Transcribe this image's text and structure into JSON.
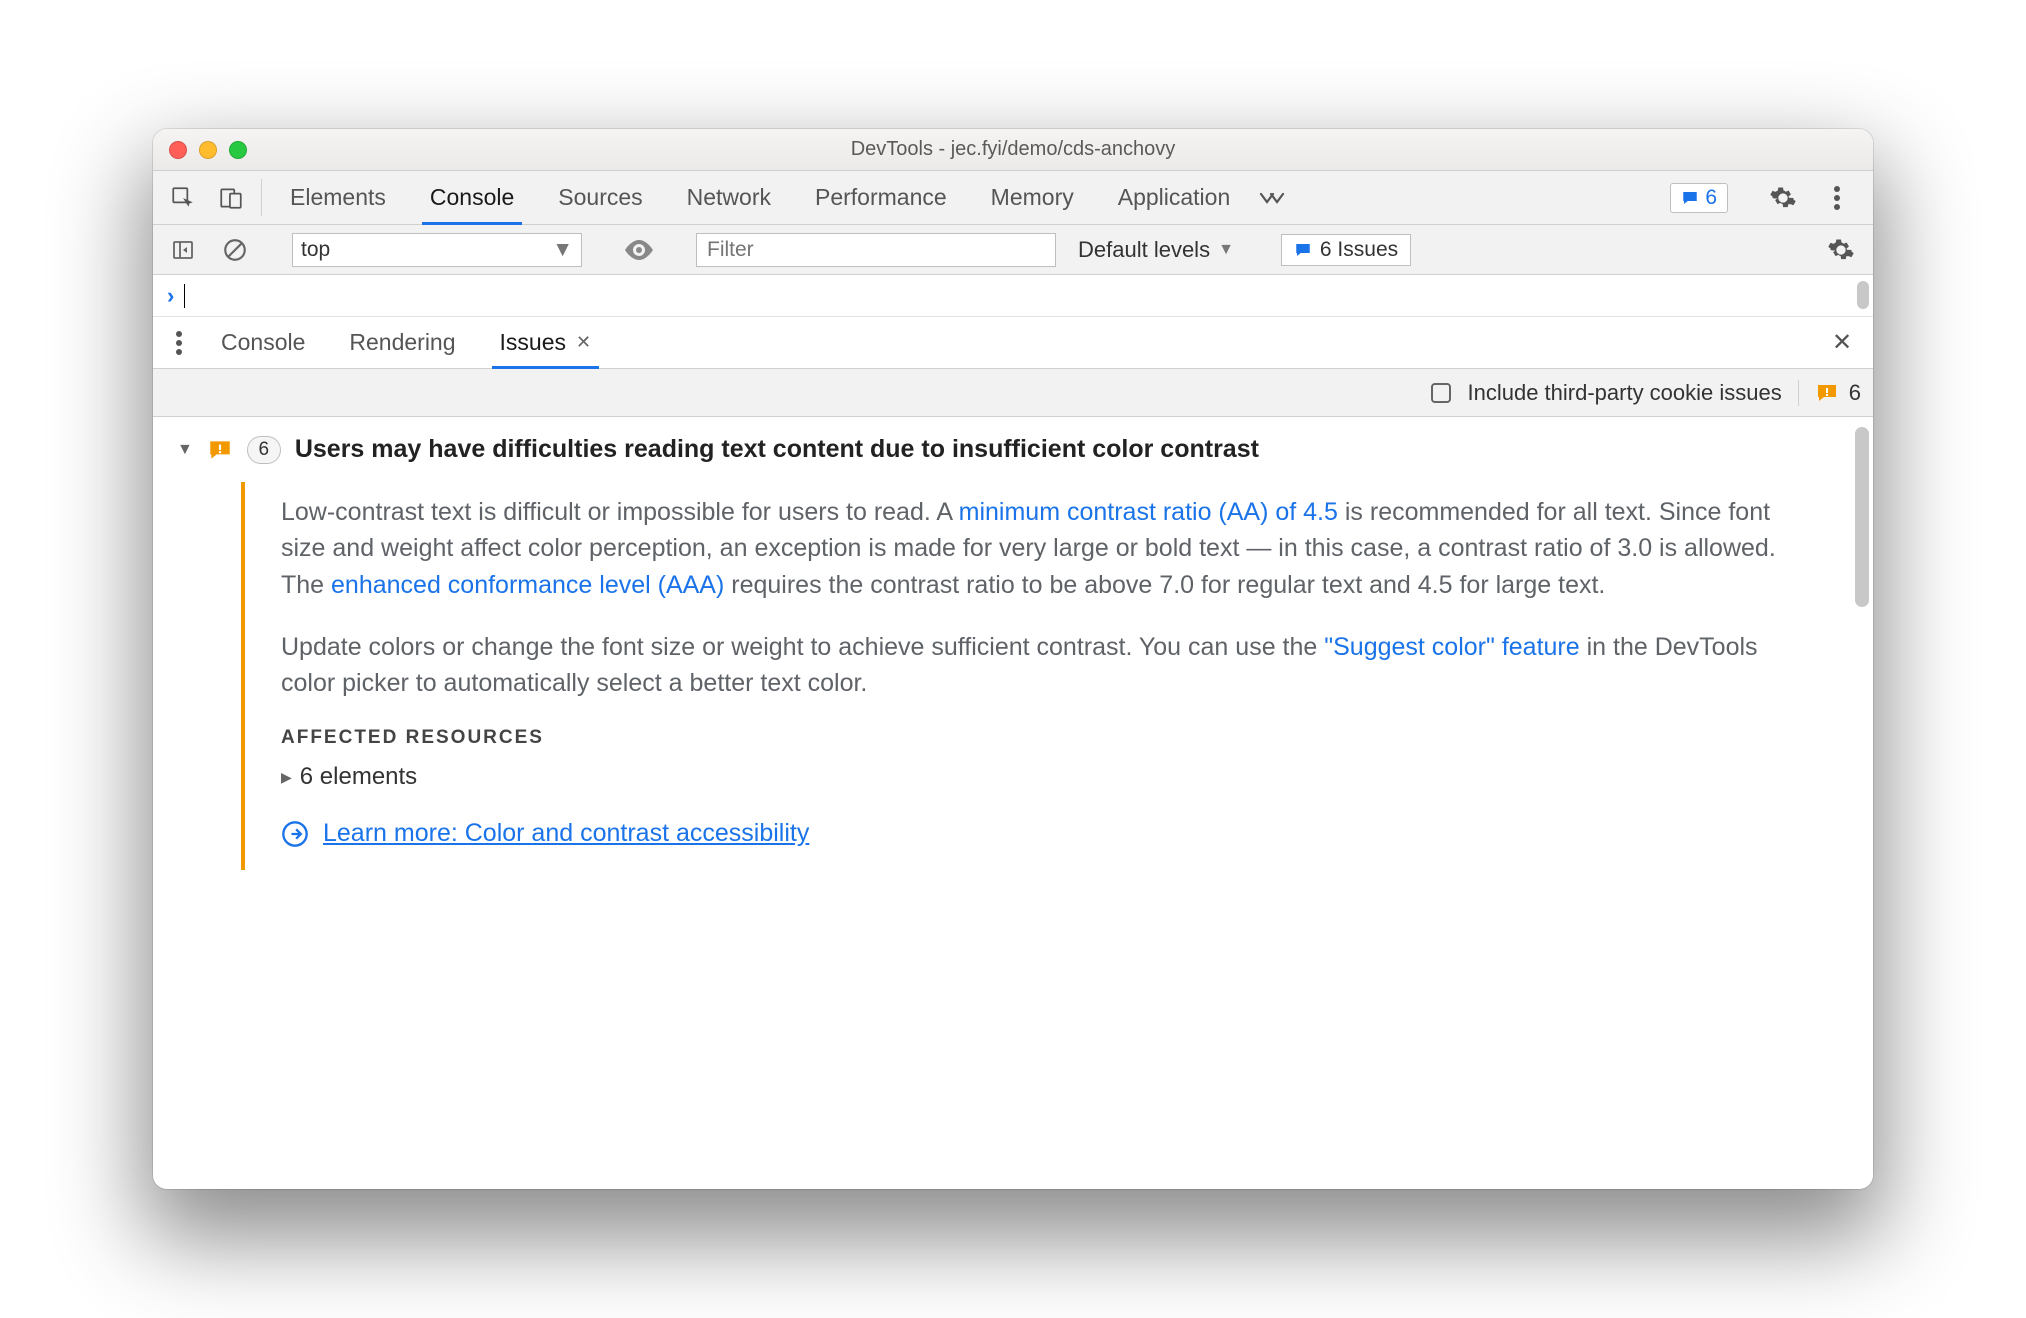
{
  "window": {
    "title": "DevTools - jec.fyi/demo/cds-anchovy"
  },
  "tabs": {
    "items": [
      "Elements",
      "Console",
      "Sources",
      "Network",
      "Performance",
      "Memory",
      "Application"
    ],
    "active": "Console",
    "overflow_badge": "6"
  },
  "console_toolbar": {
    "context": "top",
    "filter_placeholder": "Filter",
    "levels_label": "Default levels",
    "issues_label": "6 Issues"
  },
  "drawer": {
    "tabs": [
      "Console",
      "Rendering",
      "Issues"
    ],
    "active": "Issues"
  },
  "issues_toolbar": {
    "third_party_label": "Include third-party cookie issues",
    "total": "6"
  },
  "issue": {
    "count": "6",
    "title": "Users may have difficulties reading text content due to insufficient color contrast",
    "p1_a": "Low-contrast text is difficult or impossible for users to read. A ",
    "p1_link1": "minimum contrast ratio (AA) of 4.5",
    "p1_b": " is recommended for all text. Since font size and weight affect color perception, an exception is made for very large or bold text — in this case, a contrast ratio of 3.0 is allowed. The ",
    "p1_link2": "enhanced conformance level (AAA)",
    "p1_c": " requires the contrast ratio to be above 7.0 for regular text and 4.5 for large text.",
    "p2_a": "Update colors or change the font size or weight to achieve sufficient contrast. You can use the ",
    "p2_link1": "\"Suggest color\" feature",
    "p2_b": " in the DevTools color picker to automatically select a better text color.",
    "affected_title": "AFFECTED RESOURCES",
    "affected_row": "6 elements",
    "learn_label": "Learn more: Color and contrast accessibility"
  }
}
